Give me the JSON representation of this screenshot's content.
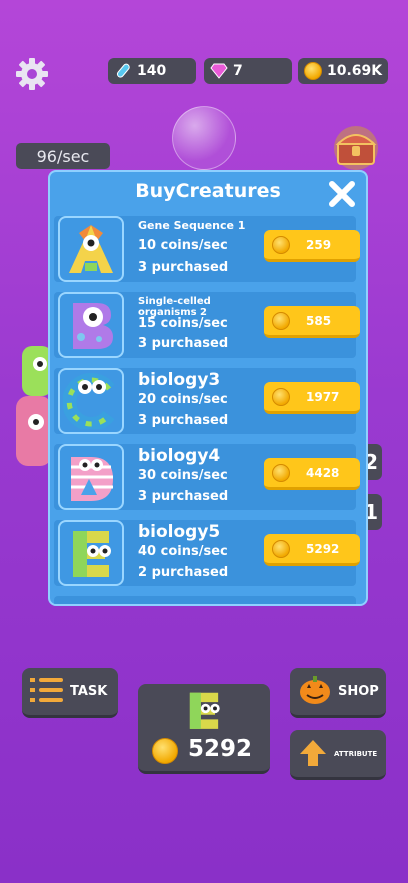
{
  "hud": {
    "resource_1": "140",
    "resource_2": "7",
    "resource_3": "10.69K",
    "rate": "96/sec",
    "side_values": [
      "2",
      "1"
    ]
  },
  "modal": {
    "title": "BuyCreatures",
    "items": [
      {
        "name": "Gene Sequence 1",
        "rate": "10 coins/sec",
        "purchased": "3 purchased",
        "price": "259"
      },
      {
        "name": "Single-celled organisms 2",
        "rate": "15 coins/sec",
        "purchased": "3 purchased",
        "price": "585"
      },
      {
        "name": "biology3",
        "rate": "20 coins/sec",
        "purchased": "3 purchased",
        "price": "1977"
      },
      {
        "name": "biology4",
        "rate": "30 coins/sec",
        "purchased": "3 purchased",
        "price": "4428"
      },
      {
        "name": "biology5",
        "rate": "40 coins/sec",
        "purchased": "2 purchased",
        "price": "5292"
      }
    ]
  },
  "bottom": {
    "task_label": "TASK",
    "shop_label": "SHOP",
    "attribute_label": "ATTRIBUTE",
    "next_cost": "5292"
  },
  "colors": {
    "background": "#9a3ad0",
    "modal": "#4aa2ea",
    "buy_button": "#ffc61a",
    "dark_panel": "#4a4a57"
  }
}
